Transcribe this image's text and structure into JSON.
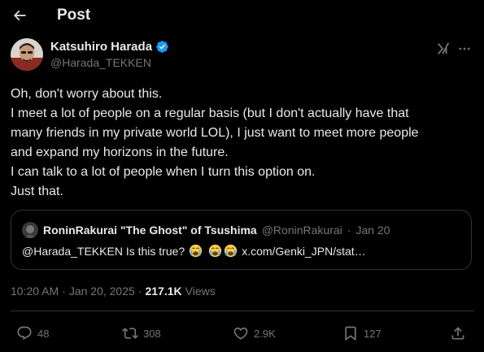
{
  "header": {
    "back_icon": "arrow-left-icon",
    "title": "Post"
  },
  "author": {
    "display_name": "Katsuhiro Harada",
    "handle": "@Harada_TEKKEN",
    "verified": true,
    "verified_color": "#1d9bf0"
  },
  "post": {
    "lines": [
      "Oh, don't worry about this.",
      "I meet a lot of people on a regular basis (but I don't actually have that",
      "many friends in my private world LOL), I just want to meet more people",
      "and expand my horizons in the future.",
      "I can talk to a lot of people when I turn this option on.",
      "Just that."
    ]
  },
  "quote": {
    "display_name": "RoninRakurai \"The Ghost\" of Tsushima",
    "handle": "@RoninRakurai",
    "dot": "·",
    "date": "Jan 20",
    "text": "@Harada_TEKKEN Is this true?",
    "emojis": [
      "crying-face-emoji",
      "crying-face-emoji",
      "crying-face-emoji"
    ],
    "link": "x.com/Genki_JPN/stat…"
  },
  "meta": {
    "time": "10:20 AM",
    "dot": "·",
    "date": "Jan 20, 2025",
    "views_count": "217.1K",
    "views_label": "Views"
  },
  "actions": {
    "replies": "48",
    "reposts": "308",
    "likes": "2.9K",
    "bookmarks": "127"
  },
  "colors": {
    "background": "#000000",
    "text": "#e7e9ea",
    "secondary": "#71767b",
    "border": "#2f3336"
  }
}
